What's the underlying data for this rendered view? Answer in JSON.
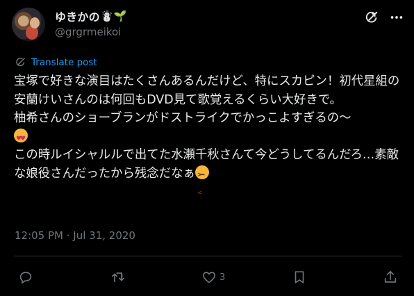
{
  "author": {
    "display_name": "ゆきかの",
    "name_emoji": "☃️🌱",
    "handle": "@grgrmeikoi"
  },
  "translate": {
    "label": "Translate post"
  },
  "post": {
    "line1": "宝塚で好きな演目はたくさんあるんだけど、特にスカピン！初代星組の安蘭けいさんのは何回もDVD見て歌覚えるくらい大好きで。",
    "line2": "柚希さんのショーブランがドストライクでかっこよすぎるの〜",
    "line3": "この時ルイシャルルで出てた水瀬千秋さんて今どうしてるんだろ…素敵な娘役さんだったから残念だなぁ",
    "emoji_1": "smiling-face-with-heart-eyes",
    "emoji_2": "tired-face"
  },
  "timestamp": "12:05 PM · Jul 31, 2020",
  "actions": {
    "reply_count": "",
    "repost_count": "",
    "like_count": "3"
  },
  "colors": {
    "background": "#000000",
    "text": "#e7e9ea",
    "muted": "#71767b",
    "accent": "#1d9bf0",
    "divider": "#2f3336"
  }
}
